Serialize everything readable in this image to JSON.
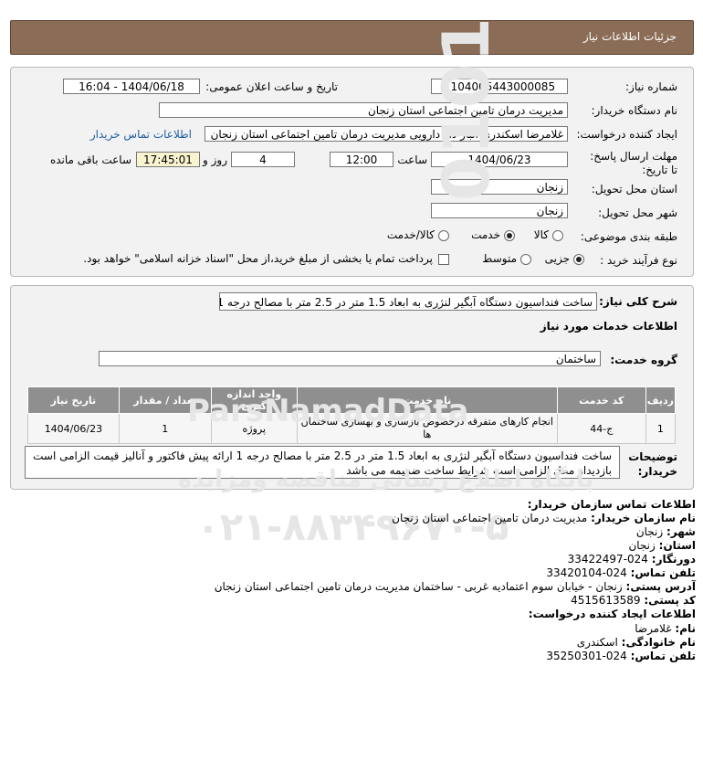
{
  "header": {
    "title": "جزئیات اطلاعات نیاز"
  },
  "fields": {
    "need_number_label": "شماره نیاز:",
    "need_number": "1104005443000085",
    "announce_label": "تاریخ و ساعت اعلان عمومی:",
    "announce_value": "1404/06/18 - 16:04",
    "buyer_label": "نام دستگاه خریدار:",
    "buyer_value": "مدیریت درمان تامین اجتماعی استان زنجان",
    "creator_label": "ایجاد کننده درخواست:",
    "creator_value": "غلامرضا  اسکندری انبار دار دارویی مدیریت درمان تامین اجتماعی استان زنجان",
    "contact_link": "اطلاعات تماس خریدار",
    "deadline_label": "مهلت ارسال پاسخ: تا تاریخ:",
    "deadline_date": "1404/06/23",
    "hour_label": "ساعت",
    "deadline_time": "12:00",
    "days_value": "4",
    "days_label": "روز و",
    "remaining_time": "17:45:01",
    "remaining_label": "ساعت باقی مانده",
    "province_label": "استان محل تحویل:",
    "province_value": "زنجان",
    "city_label": "شهر محل تحویل:",
    "city_value": "زنجان",
    "category_label": "طبقه بندی موضوعی:",
    "category_options": [
      "کالا",
      "خدمت",
      "کالا/خدمت"
    ],
    "category_selected": "خدمت",
    "process_label": "نوع فرآیند خرید :",
    "process_options": [
      "جزیی",
      "متوسط"
    ],
    "process_selected": "جزیی",
    "payment_note": "پرداخت تمام یا بخشی از مبلغ خرید،از محل \"اسناد خزانه اسلامی\" خواهد بود."
  },
  "summary": {
    "label": "شرح کلی نیاز:",
    "value": "ساخت فنداسیون دستگاه آبگیر لنژری به ابعاد 1.5 متر در 2.5 متر با مصالح درجه 1"
  },
  "services": {
    "section_title": "اطلاعات خدمات مورد نیاز",
    "group_label": "گروه خدمت:",
    "group_value": "ساختمان",
    "columns": [
      "ردیف",
      "کد خدمت",
      "نام خدمت",
      "واحد اندازه گیری",
      "تعداد / مقدار",
      "تاریخ نیاز"
    ],
    "rows": [
      {
        "row": "1",
        "code": "ج-44",
        "name": "انجام کارهای متفرقه درخصوص بازسازی و بهسازی ساختمان ها",
        "unit": "پروژه",
        "qty": "1",
        "date": "1404/06/23"
      }
    ]
  },
  "buyer_notes": {
    "label": "توضیحات خریدار:",
    "value": "ساخت فنداسیون دستگاه آبگیر لنژری به ابعاد 1.5 متر در 2.5 متر با مصالح درجه 1 ارائه پیش فاکتور و آنالیز قیمت الزامی است بازدیداز محل الزامی است شرایط ساخت ضمیمه می باشد"
  },
  "contact": {
    "org_title": "اطلاعات تماس سازمان خریدار:",
    "org_name_label": "نام سازمان خریدار:",
    "org_name": "مدیریت درمان تامین اجتماعی استان زنجان",
    "city_label": "شهر:",
    "city": "زنجان",
    "province_label": "استان:",
    "province": "زنجان",
    "fax_label": "دورنگار:",
    "fax": "024-33422497",
    "phone_label": "تلفن تماس:",
    "phone": "024-33420104",
    "address_label": "آدرس پستی:",
    "address": "زنجان - خیابان سوم اعتمادیه غربی - ساختمان مدیریت درمان تامین اجتماعی استان زنجان",
    "postal_label": "کد پستی:",
    "postal": "4515613589",
    "creator_title": "اطلاعات ایجاد کننده درخواست:",
    "first_name_label": "نام:",
    "first_name": "غلامرضا",
    "last_name_label": "نام خانوادگی:",
    "last_name": "اسکندری",
    "creator_phone_label": "تلفن تماس:",
    "creator_phone": "024-35250301"
  },
  "watermark": {
    "brand": "ParsNamadData",
    "tagline": "پایگاه اطلاع رسانی مناقصه ومزایده",
    "phone": "۰۲۱-۸۸۳۴۹۶۷۰-۵",
    "digits": "0101"
  }
}
